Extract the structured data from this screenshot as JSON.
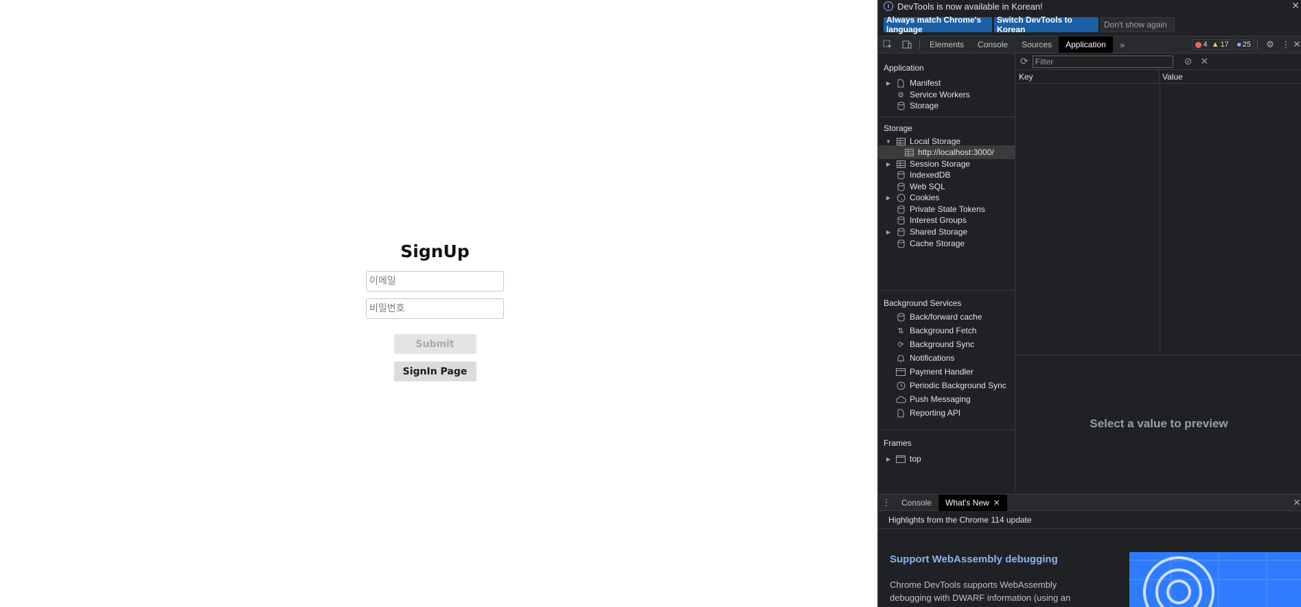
{
  "page": {
    "title": "SignUp",
    "email_placeholder": "이메일",
    "password_placeholder": "비밀번호",
    "submit_label": "Submit",
    "signin_label": "SignIn Page"
  },
  "devtools": {
    "infobar": {
      "message": "DevTools is now available in Korean!",
      "buttons": [
        "Always match Chrome's language",
        "Switch DevTools to Korean",
        "Don't show again"
      ]
    },
    "tabs": [
      "Elements",
      "Console",
      "Sources",
      "Application"
    ],
    "active_tab": "Application",
    "counts": {
      "errors": "4",
      "warnings": "17",
      "messages": "25"
    },
    "sidebar": {
      "application_title": "Application",
      "application_items": [
        "Manifest",
        "Service Workers",
        "Storage"
      ],
      "storage_title": "Storage",
      "storage_items": [
        "Local Storage",
        "http://localhost:3000/",
        "Session Storage",
        "IndexedDB",
        "Web SQL",
        "Cookies",
        "Private State Tokens",
        "Interest Groups",
        "Shared Storage",
        "Cache Storage"
      ],
      "background_title": "Background Services",
      "background_items": [
        "Back/forward cache",
        "Background Fetch",
        "Background Sync",
        "Notifications",
        "Payment Handler",
        "Periodic Background Sync",
        "Push Messaging",
        "Reporting API"
      ],
      "frames_title": "Frames",
      "frames_items": [
        "top"
      ]
    },
    "main": {
      "filter_placeholder": "Filter",
      "col_key": "Key",
      "col_value": "Value",
      "preview_text": "Select a value to preview"
    },
    "drawer": {
      "tabs": [
        "Console",
        "What's New"
      ],
      "active_tab": "What's New",
      "highlights": "Highlights from the Chrome 114 update",
      "news_title": "Support WebAssembly debugging",
      "news_text": "Chrome DevTools supports WebAssembly debugging with DWARF information (using an"
    },
    "colors": {
      "accent": "#1a5fa6",
      "link": "#8ab4f8",
      "background": "#202124"
    }
  }
}
